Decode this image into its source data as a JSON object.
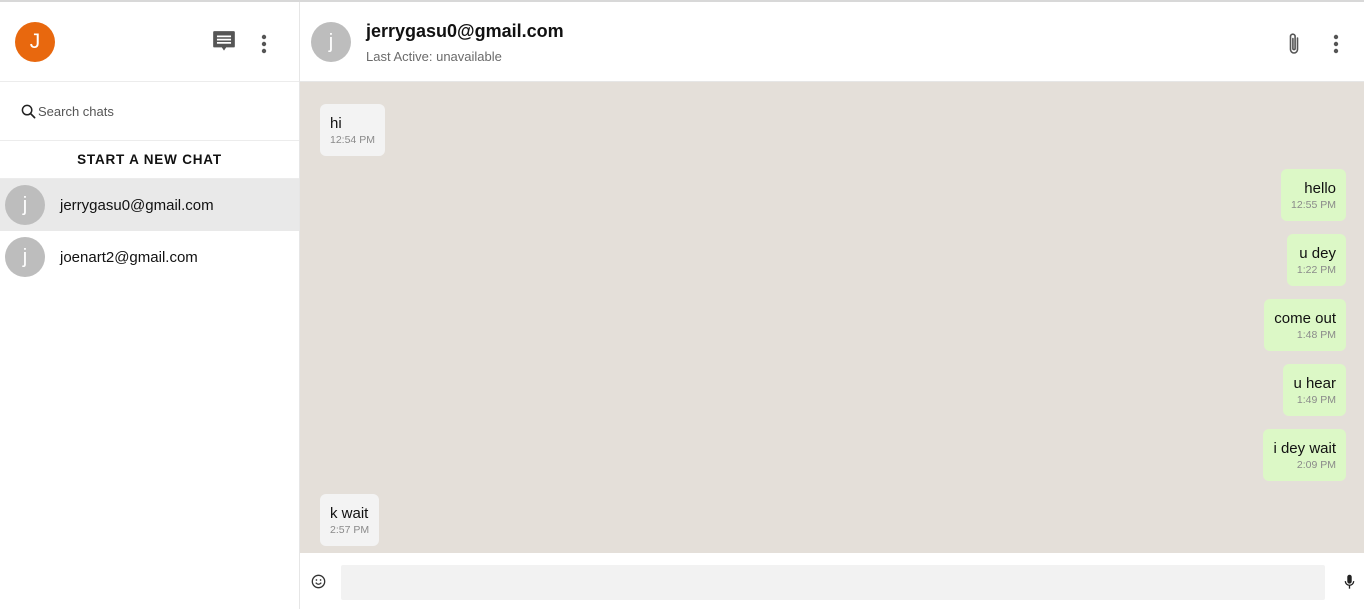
{
  "sidebar": {
    "user_initial": "J",
    "search_placeholder": "Search chats",
    "new_chat_label": "START A NEW CHAT",
    "chats": [
      {
        "initial": "j",
        "name": "jerrygasu0@gmail.com",
        "active": true
      },
      {
        "initial": "j",
        "name": "joenart2@gmail.com",
        "active": false
      }
    ]
  },
  "header": {
    "initial": "j",
    "name": "jerrygasu0@gmail.com",
    "status": "Last Active: unavailable"
  },
  "messages": [
    {
      "direction": "in",
      "text": "hi",
      "time": "12:54 PM"
    },
    {
      "direction": "out",
      "text": "hello",
      "time": "12:55 PM"
    },
    {
      "direction": "out",
      "text": "u dey",
      "time": "1:22 PM"
    },
    {
      "direction": "out",
      "text": "come out",
      "time": "1:48 PM"
    },
    {
      "direction": "out",
      "text": "u hear",
      "time": "1:49 PM"
    },
    {
      "direction": "out",
      "text": "i dey wait",
      "time": "2:09 PM"
    },
    {
      "direction": "in",
      "text": "k wait",
      "time": "2:57 PM"
    }
  ],
  "composer": {
    "value": "",
    "placeholder": ""
  },
  "colors": {
    "user_avatar": "#e8680e",
    "contact_avatar": "#bdbdbd",
    "chat_background": "#e4dfd9",
    "outgoing_bubble": "#dcf8c6",
    "incoming_bubble": "#f3f3f3"
  },
  "icons": {
    "new_chat": "message-icon",
    "sidebar_menu": "more-vertical-icon",
    "search": "search-icon",
    "attach": "paperclip-icon",
    "chat_menu": "more-vertical-icon",
    "emoji": "emoji-icon",
    "mic": "mic-icon"
  }
}
